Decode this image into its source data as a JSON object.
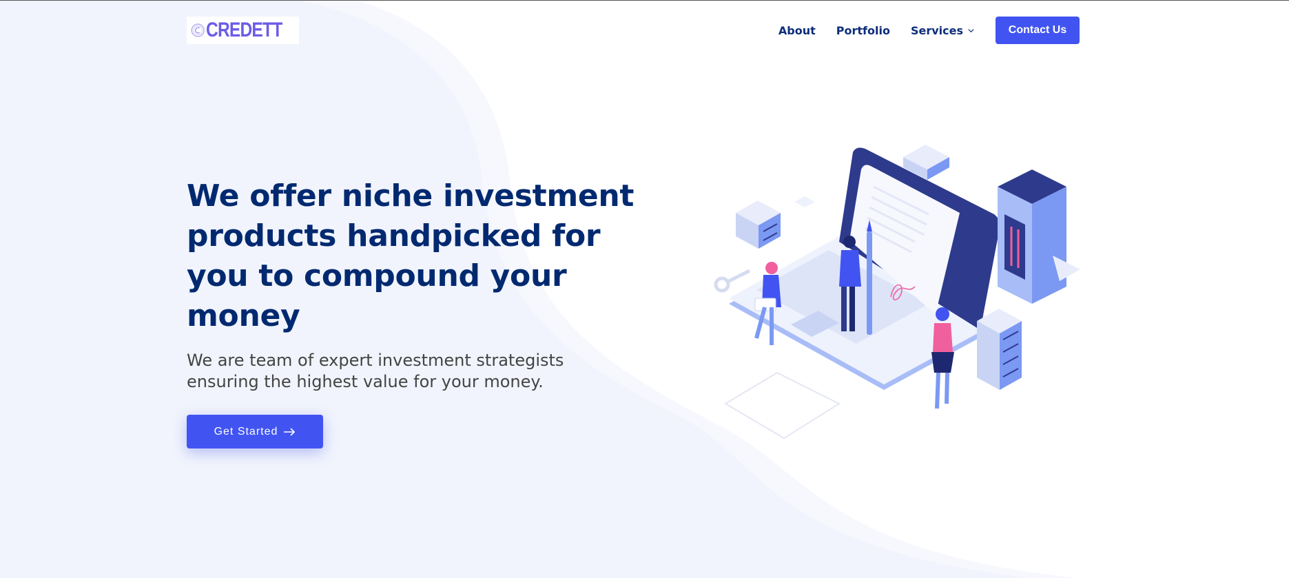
{
  "brand": {
    "name": "CREDETT",
    "logo_icon": "copyright-c-icon"
  },
  "nav": {
    "items": [
      {
        "label": "About"
      },
      {
        "label": "Portfolio"
      },
      {
        "label": "Services",
        "icon": "chevron-down-icon"
      }
    ],
    "contact_label": "Contact Us"
  },
  "hero": {
    "title": "We offer niche investment products handpicked for you to compound your money",
    "subtitle": "We are team of expert investment strategists ensuring the highest value for your money.",
    "cta_label": "Get Started",
    "cta_icon": "arrow-right-icon"
  },
  "colors": {
    "primary": "#4154f1",
    "heading": "#012970",
    "nav_text": "#0d2d7a",
    "body_text": "#444444",
    "hero_bg": "#f1f4fc",
    "accent_pink": "#f0609e"
  }
}
